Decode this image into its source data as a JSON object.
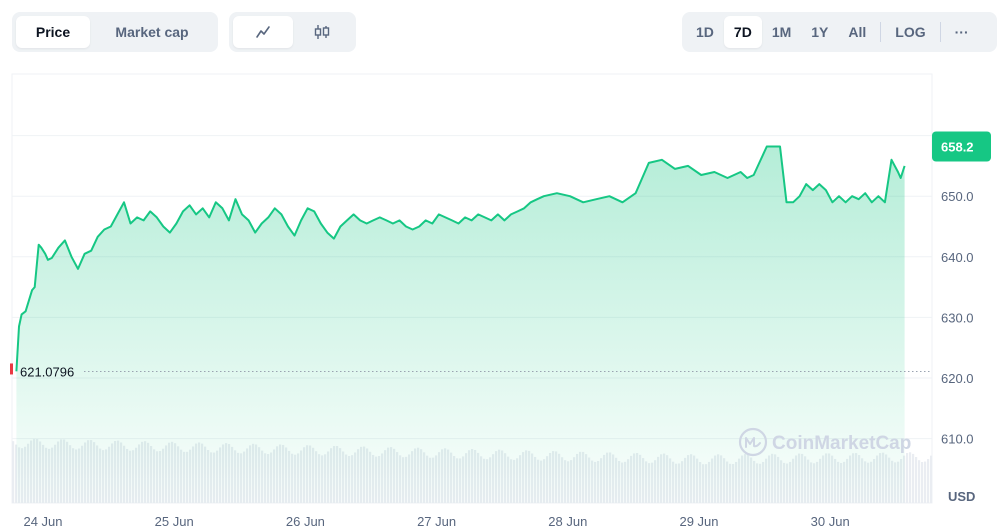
{
  "toolbar": {
    "metric_tabs": [
      "Price",
      "Market cap"
    ],
    "chart_types": [
      {
        "icon": "line-chart-icon",
        "active": true
      },
      {
        "icon": "candlestick-icon",
        "active": false
      }
    ],
    "ranges": [
      "1D",
      "7D",
      "1M",
      "1Y",
      "All"
    ],
    "active_range": "7D",
    "log_label": "LOG",
    "more_label": "···"
  },
  "watermark": "CoinMarketCap",
  "colors": {
    "line": "#16c784",
    "start_marker": "#ea3943",
    "grid": "#eff2f5",
    "volume": "#eaedf2"
  },
  "chart_data": {
    "type": "line",
    "ylabel": "USD",
    "yticks": [
      "610.0",
      "620.0",
      "630.0",
      "640.0",
      "650.0"
    ],
    "ylim": [
      605,
      668
    ],
    "xticks": [
      "24 Jun",
      "25 Jun",
      "26 Jun",
      "27 Jun",
      "28 Jun",
      "29 Jun",
      "30 Jun"
    ],
    "x_start": 23.98,
    "x_end": 30.75,
    "start_value": 621.0796,
    "start_value_label": "621.0796",
    "current_value": 658.2,
    "current_value_label": "658.2",
    "series": [
      {
        "x": [
          23.98,
          24.0,
          24.02,
          24.05,
          24.1,
          24.12,
          24.15,
          24.17,
          24.2,
          24.22,
          24.25,
          24.3,
          24.35,
          24.4,
          24.45,
          24.5,
          24.55,
          24.6,
          24.65,
          24.7,
          24.75,
          24.8,
          24.85,
          24.9,
          24.95,
          25.0,
          25.05,
          25.1,
          25.15,
          25.2,
          25.25,
          25.3,
          25.35,
          25.4,
          25.45,
          25.5,
          25.55,
          25.6,
          25.65,
          25.7,
          25.75,
          25.8,
          25.85,
          25.9,
          25.95,
          26.0,
          26.05,
          26.1,
          26.15,
          26.2,
          26.25,
          26.3,
          26.35,
          26.4,
          26.45,
          26.5,
          26.55,
          26.6,
          26.65,
          26.7,
          26.75,
          26.8,
          26.85,
          26.9,
          26.95,
          27.0,
          27.05,
          27.1,
          27.15,
          27.2,
          27.25,
          27.3,
          27.35,
          27.4,
          27.45,
          27.5,
          27.55,
          27.6,
          27.65,
          27.7,
          27.75,
          27.8,
          27.85,
          27.9,
          27.95,
          28.0,
          28.1,
          28.2,
          28.3,
          28.4,
          28.5,
          28.6,
          28.7,
          28.8,
          28.9,
          29.0,
          29.1,
          29.2,
          29.3,
          29.4,
          29.5,
          29.55,
          29.6,
          29.7,
          29.8,
          29.85,
          29.9,
          29.95,
          30.0,
          30.05,
          30.1,
          30.15,
          30.2,
          30.25,
          30.3,
          30.35,
          30.4,
          30.45,
          30.5,
          30.55,
          30.6,
          30.65,
          30.7,
          30.72,
          30.75
        ],
        "values": [
          621.1,
          628.5,
          630.5,
          631.0,
          634.5,
          635.0,
          642.0,
          641.5,
          640.5,
          639.5,
          639.8,
          641.5,
          642.7,
          640.0,
          638.0,
          640.5,
          641.0,
          643.3,
          644.5,
          645.0,
          647.0,
          649.0,
          645.5,
          646.5,
          646.0,
          647.5,
          646.5,
          645.0,
          644.0,
          645.5,
          647.5,
          648.5,
          647.0,
          648.0,
          646.5,
          649.0,
          648.0,
          646.0,
          649.5,
          647.0,
          646.0,
          644.0,
          645.5,
          646.5,
          648.0,
          647.0,
          645.0,
          643.5,
          646.0,
          648.0,
          647.5,
          645.5,
          644.0,
          643.0,
          645.0,
          646.0,
          647.0,
          646.0,
          645.5,
          646.0,
          646.5,
          646.0,
          645.5,
          646.0,
          645.0,
          644.5,
          645.0,
          646.0,
          645.5,
          647.0,
          646.5,
          646.0,
          645.5,
          646.5,
          646.0,
          647.0,
          646.5,
          646.0,
          647.0,
          646.0,
          647.0,
          647.5,
          648.0,
          649.0,
          649.5,
          650.0,
          650.5,
          650.0,
          649.0,
          649.5,
          650.0,
          649.0,
          650.5,
          655.5,
          656.0,
          654.5,
          655.0,
          653.5,
          654.0,
          653.0,
          654.0,
          653.0,
          653.5,
          658.2,
          658.2,
          649.0,
          649.0,
          650.0,
          652.0,
          651.0,
          652.0,
          651.0,
          649.0,
          650.0,
          649.0,
          650.0,
          649.5,
          650.5,
          649.0,
          650.0,
          649.0,
          656.0,
          654.0,
          653.0,
          655.0
        ]
      }
    ]
  }
}
